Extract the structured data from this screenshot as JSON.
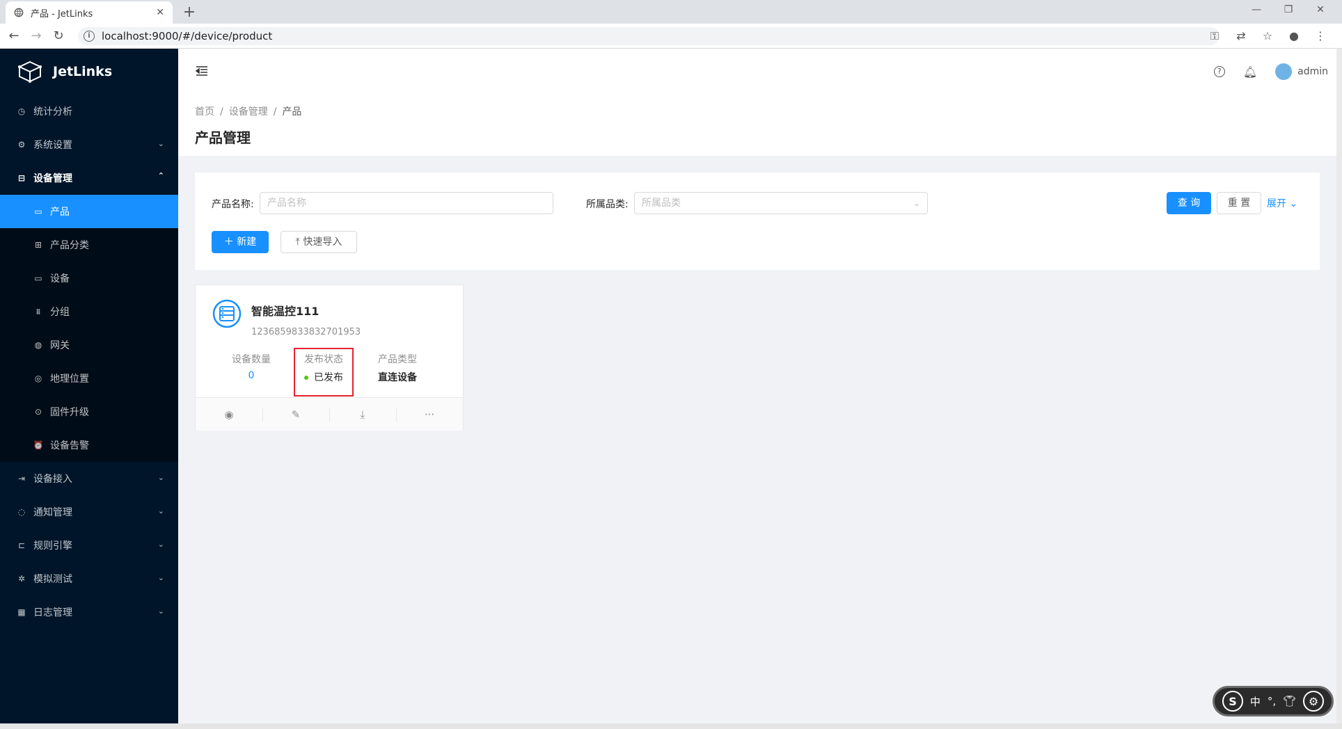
{
  "browser": {
    "tab_title": "产品 - JetLinks",
    "url": "localhost:9000/#/device/product"
  },
  "sidebar": {
    "logo_text": "JetLinks",
    "items": [
      {
        "label": "统计分析",
        "icon": "dashboard-icon"
      },
      {
        "label": "系统设置",
        "icon": "gear-icon"
      },
      {
        "label": "设备管理",
        "icon": "device-icon"
      }
    ],
    "submenu": [
      {
        "label": "产品",
        "icon": "laptop-icon"
      },
      {
        "label": "产品分类",
        "icon": "grid-icon"
      },
      {
        "label": "设备",
        "icon": "monitor-icon"
      },
      {
        "label": "分组",
        "icon": "cluster-icon"
      },
      {
        "label": "网关",
        "icon": "globe-icon"
      },
      {
        "label": "地理位置",
        "icon": "compass-icon"
      },
      {
        "label": "固件升级",
        "icon": "upgrade-icon"
      },
      {
        "label": "设备告警",
        "icon": "alarm-icon"
      }
    ],
    "items_bottom": [
      {
        "label": "设备接入",
        "icon": "login-icon"
      },
      {
        "label": "通知管理",
        "icon": "message-icon"
      },
      {
        "label": "规则引擎",
        "icon": "rule-icon"
      },
      {
        "label": "模拟测试",
        "icon": "bug-icon"
      },
      {
        "label": "日志管理",
        "icon": "calendar-icon"
      }
    ]
  },
  "header": {
    "user": "admin"
  },
  "page": {
    "breadcrumb": [
      "首页",
      "设备管理",
      "产品"
    ],
    "title": "产品管理"
  },
  "search": {
    "name_label": "产品名称:",
    "name_placeholder": "产品名称",
    "category_label": "所属品类:",
    "category_placeholder": "所属品类",
    "query_btn": "查 询",
    "reset_btn": "重 置",
    "expand_link": "展开",
    "new_btn": "新建",
    "import_btn": "快速导入"
  },
  "product": {
    "name": "智能温控111",
    "id": "1236859833832701953",
    "device_count_label": "设备数量",
    "device_count": "0",
    "status_label": "发布状态",
    "status": "已发布",
    "type_label": "产品类型",
    "type": "直连设备"
  },
  "ime": {
    "lang": "中",
    "punct": "°,"
  },
  "colors": {
    "primary": "#1890ff",
    "sidebar": "#001529",
    "success": "#52c41a",
    "highlight": "#e5222c"
  }
}
